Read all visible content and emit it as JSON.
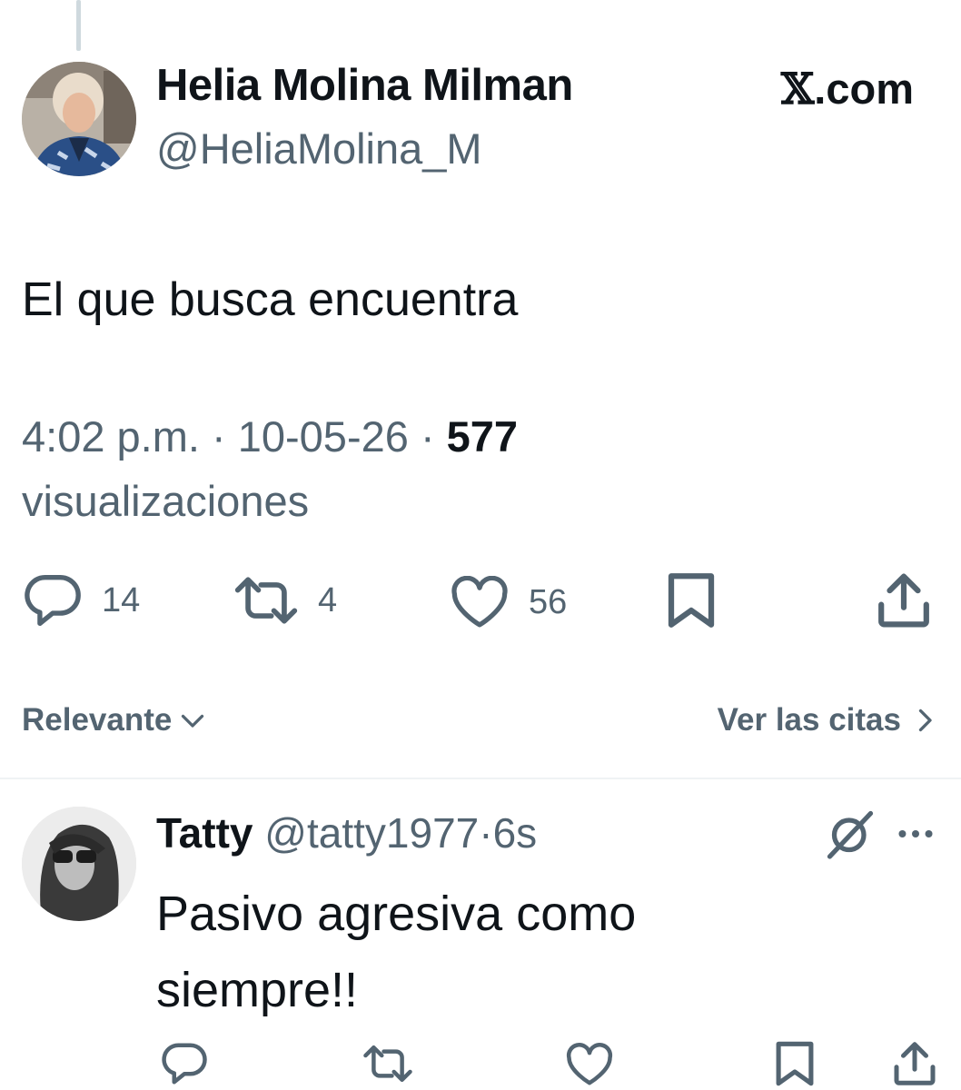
{
  "brand": {
    "symbol": "𝕏",
    "text": ".com"
  },
  "tweet": {
    "author_name": "Helia Molina Milman",
    "author_handle": "@HeliaMolina_M",
    "text": "El que busca encuentra",
    "time": "4:02 p.m.",
    "date": "10-05-26",
    "separator": "·",
    "views_count": "577",
    "views_label": "visualizaciones",
    "stats": {
      "replies": "14",
      "reposts": "4",
      "likes": "56"
    }
  },
  "filters": {
    "sort_label": "Relevante",
    "quotes_label": "Ver las citas"
  },
  "reply": {
    "author_name": "Tatty",
    "author_handle": "@tatty1977",
    "separator": "·",
    "time": "6s",
    "text": "Pasivo agresiva como siempre!!"
  },
  "icons": [
    "reply-icon",
    "repost-icon",
    "like-icon",
    "bookmark-icon",
    "share-icon",
    "chevron-down-icon",
    "chevron-right-icon",
    "grok-icon",
    "more-icon"
  ],
  "colors": {
    "text": "#0f1419",
    "secondary": "#536471",
    "divider": "#eff3f4",
    "background": "#ffffff"
  }
}
